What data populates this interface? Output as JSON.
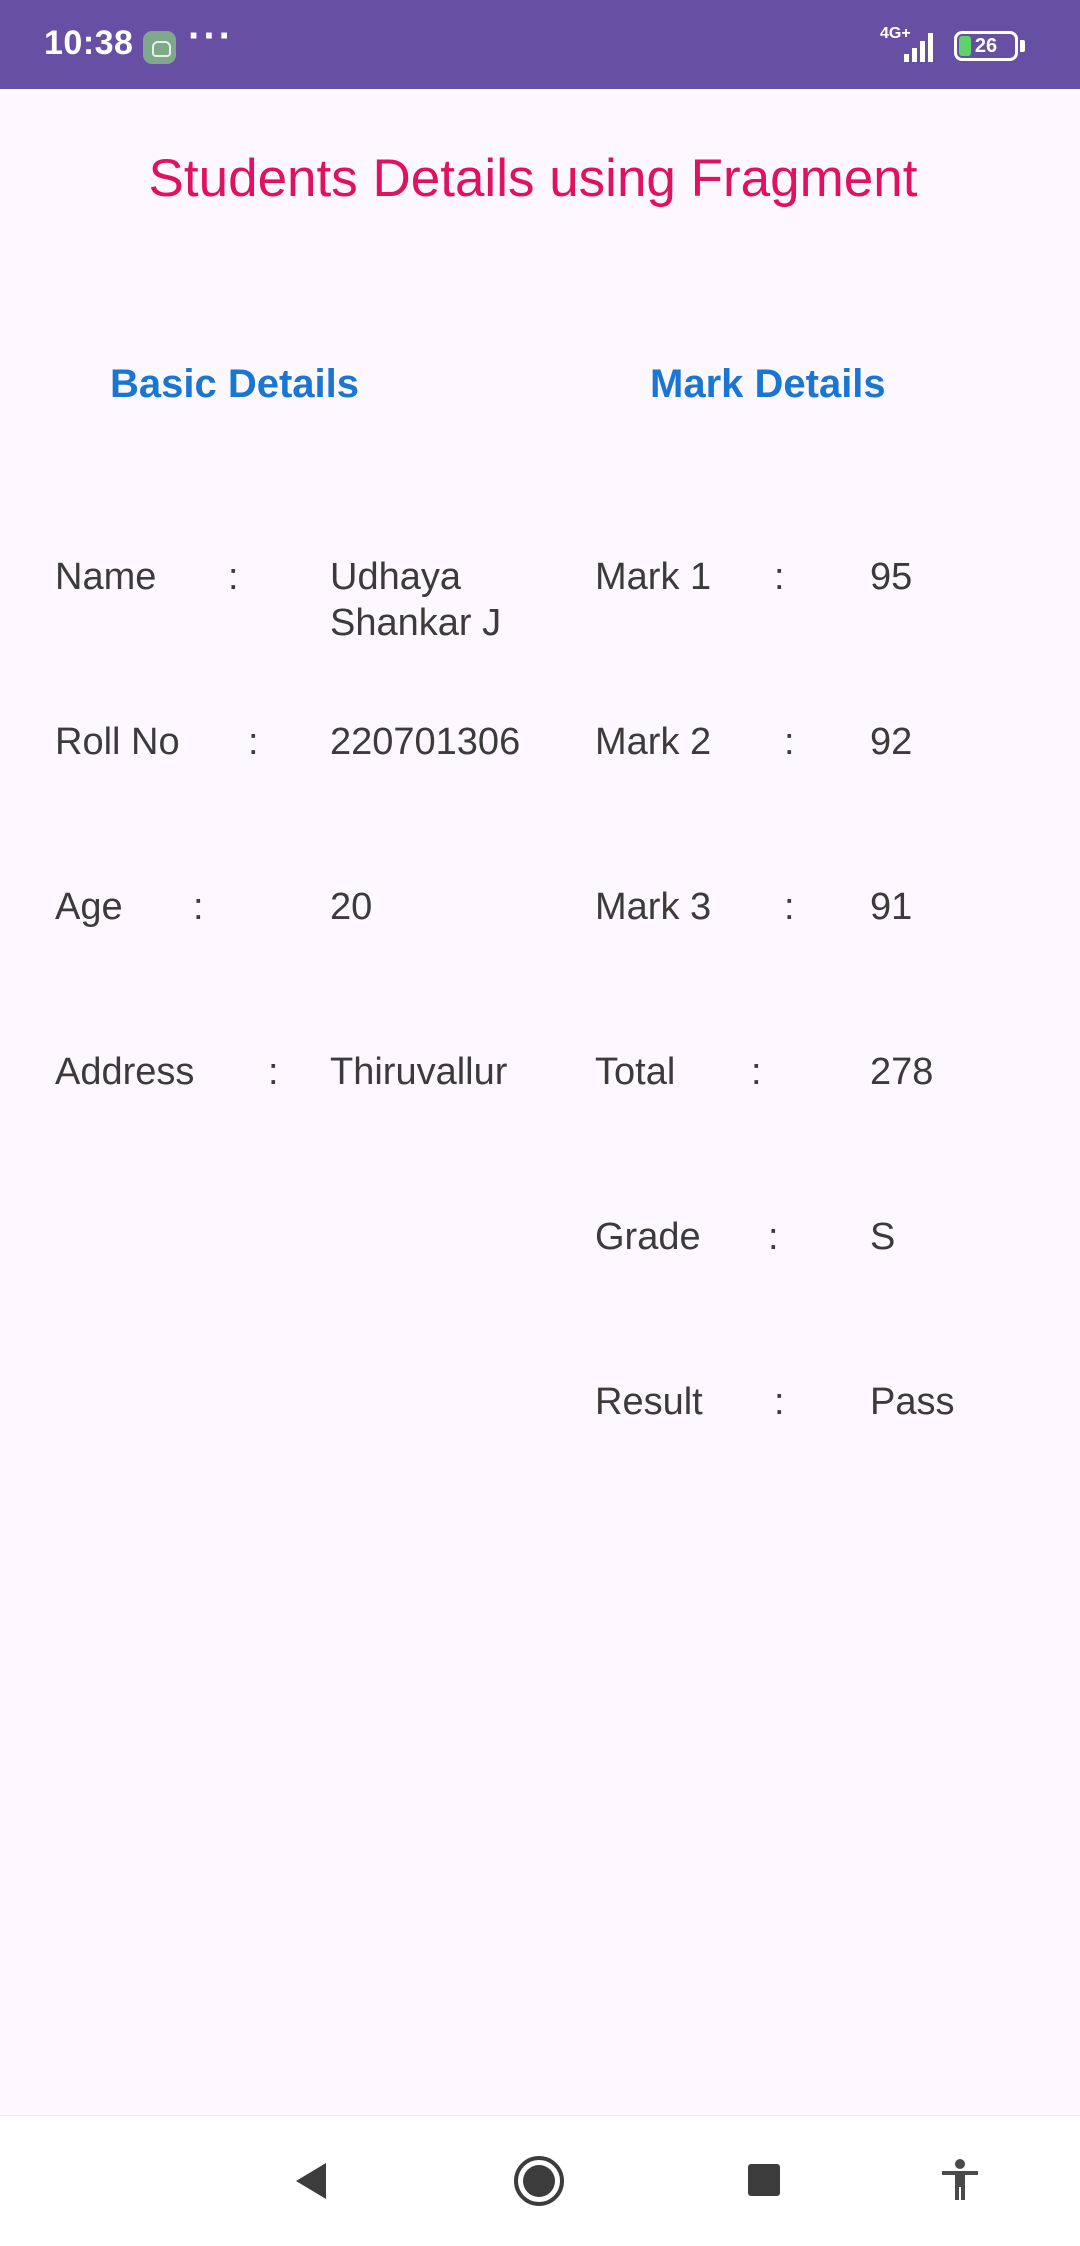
{
  "status_bar": {
    "time": "10:38",
    "dots": "···",
    "network": "4G+",
    "battery": "26",
    "app_icon": "android-app-icon",
    "signal_icon": "signal-icon",
    "battery_icon": "battery-icon"
  },
  "title": "Students Details using Fragment",
  "colors": {
    "title": "#e0115f",
    "heading": "#1976d2",
    "status_bar": "#6750a4",
    "background": "#fdf7ff"
  },
  "basic": {
    "heading": "Basic Details",
    "rows": [
      {
        "label": "Name",
        "sep": ":",
        "value": "Udhaya\nShankar J"
      },
      {
        "label": "Roll No",
        "sep": ":",
        "value": "220701306"
      },
      {
        "label": "Age",
        "sep": ":",
        "value": "20"
      },
      {
        "label": "Address",
        "sep": ":",
        "value": "Thiruvallur"
      }
    ]
  },
  "marks": {
    "heading": "Mark Details",
    "rows": [
      {
        "label": "Mark 1",
        "sep": ":",
        "value": "95"
      },
      {
        "label": "Mark 2",
        "sep": ":",
        "value": "92"
      },
      {
        "label": "Mark 3",
        "sep": ":",
        "value": "91"
      },
      {
        "label": "Total",
        "sep": ":",
        "value": "278"
      },
      {
        "label": "Grade",
        "sep": ":",
        "value": "S"
      },
      {
        "label": "Result",
        "sep": ":",
        "value": "Pass"
      }
    ]
  },
  "nav": {
    "back": "back-icon",
    "home": "home-icon",
    "recents": "recents-icon",
    "accessibility": "accessibility-icon"
  }
}
